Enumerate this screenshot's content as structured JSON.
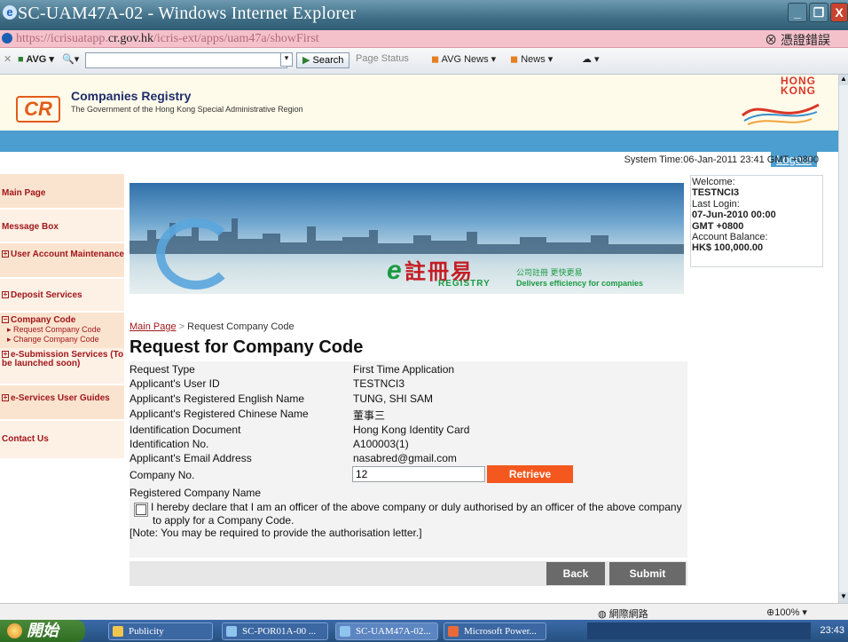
{
  "window": {
    "title": "SC-UAM47A-02 - Windows Internet Explorer",
    "minimize": "_",
    "restore": "❐",
    "close": "X"
  },
  "address": {
    "url_prefix": "https://icrisuatapp.",
    "url_host": "cr.gov.hk",
    "url_path": "/icris-ext/apps/uam47a/showFirst",
    "cert_error": "憑證錯誤"
  },
  "toolbar": {
    "avg_label": "AVG",
    "search_label": "Search",
    "page_status": "Page Status",
    "avg_news": "AVG News",
    "news": "News"
  },
  "header": {
    "logo_text": "CR",
    "org_name": "Companies Registry",
    "org_subtitle": "The Government of the Hong Kong Special Administrative Region",
    "brand_line1": "HONG",
    "brand_line2": "KONG"
  },
  "logout_label": "Logout",
  "system_time": "System Time:06-Jan-2011 23:41 GMT +0800",
  "sidebar": {
    "main_page": "Main Page",
    "message_box": "Message Box",
    "user_account": "User Account Maintenance",
    "deposit_services": "Deposit Services",
    "company_code": "Company Code",
    "request_company_code": "Request Company Code",
    "change_company_code": "Change Company Code",
    "e_submission": "e-Submission Services (To be launched soon)",
    "e_services_guides": "e-Services User Guides",
    "contact_us": "Contact Us"
  },
  "banner": {
    "chinese_title": "註冊易",
    "registry_word": "REGISTRY",
    "chinese_slogan": "公司註冊 更快更易",
    "english_slogan": "Delivers efficiency for companies"
  },
  "welcome": {
    "welcome_label": "Welcome:",
    "user": "TESTNCI3",
    "last_login_label": "Last Login:",
    "last_login_value": "07-Jun-2010 00:00 GMT +0800",
    "balance_label": "Account Balance:",
    "balance_value": "HK$ 100,000.00"
  },
  "breadcrumb": {
    "home": "Main Page",
    "separator": ">",
    "current": "Request Company Code"
  },
  "page_title": "Request for Company Code",
  "form": {
    "rows": [
      {
        "label": "Request Type",
        "value": "First Time Application"
      },
      {
        "label": "Applicant's User ID",
        "value": "TESTNCI3"
      },
      {
        "label": "Applicant's Registered English Name",
        "value": "TUNG, SHI SAM"
      },
      {
        "label": "Applicant's Registered Chinese Name",
        "value": "董事三"
      },
      {
        "label": "Identification Document",
        "value": "Hong Kong Identity Card"
      },
      {
        "label": "Identification No.",
        "value": "A100003(1)"
      },
      {
        "label": "Applicant's Email Address",
        "value": "nasabred@gmail.com"
      }
    ],
    "company_no_label": "Company No.",
    "company_no_value": "12",
    "retrieve_label": "Retrieve",
    "registered_name_label": "Registered Company Name",
    "declaration": "I hereby declare that I am an officer of the above company or duly authorised by an officer of the above company to apply for a Company Code.",
    "note": "[Note: You may be required to provide the authorisation letter.]",
    "back_label": "Back",
    "submit_label": "Submit"
  },
  "statusbar": {
    "zone": "網際網路",
    "zoom": "100%"
  },
  "taskbar": {
    "start_label": "開始",
    "items": [
      "Publicity",
      "SC-POR01A-00 ...",
      "SC-UAM47A-02...",
      "Microsoft Power..."
    ],
    "clock": "23:43"
  }
}
